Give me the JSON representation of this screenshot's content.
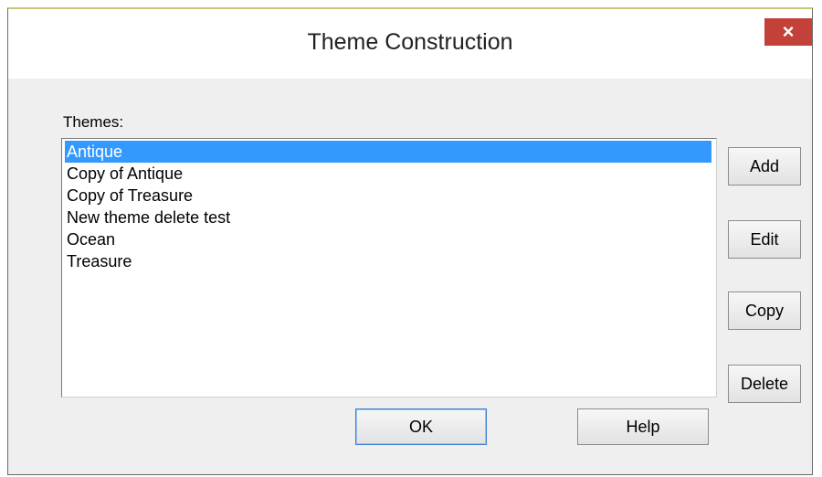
{
  "dialog": {
    "title": "Theme Construction",
    "close_glyph": "×"
  },
  "themes": {
    "label": "Themes:",
    "items": [
      {
        "label": "Antique",
        "selected": true
      },
      {
        "label": "Copy of Antique",
        "selected": false
      },
      {
        "label": "Copy of Treasure",
        "selected": false
      },
      {
        "label": "New theme delete test",
        "selected": false
      },
      {
        "label": "Ocean",
        "selected": false
      },
      {
        "label": "Treasure",
        "selected": false
      }
    ]
  },
  "side_buttons": {
    "add": "Add",
    "edit": "Edit",
    "copy": "Copy",
    "delete": "Delete"
  },
  "footer_buttons": {
    "ok": "OK",
    "help": "Help"
  },
  "colors": {
    "selection": "#3399ff",
    "close_button": "#c4413a"
  }
}
